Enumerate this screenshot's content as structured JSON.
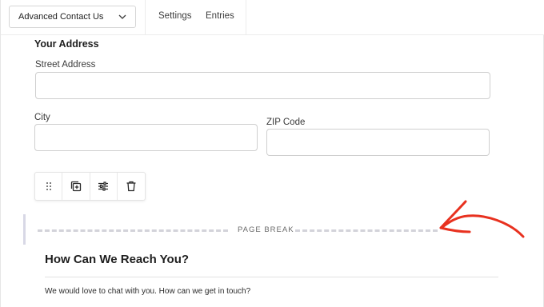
{
  "header": {
    "form_select": {
      "label": "Advanced Contact Us",
      "icon": "chevron-down-icon"
    },
    "tabs": [
      {
        "label": "Settings"
      },
      {
        "label": "Entries"
      }
    ]
  },
  "address_section": {
    "title": "Your Address",
    "fields": {
      "street": {
        "label": "Street Address",
        "value": ""
      },
      "city": {
        "label": "City",
        "value": ""
      },
      "zip": {
        "label": "ZIP Code",
        "value": ""
      }
    }
  },
  "block_toolbar": {
    "buttons": [
      {
        "icon": "drag-handle-icon"
      },
      {
        "icon": "duplicate-icon"
      },
      {
        "icon": "settings-sliders-icon"
      },
      {
        "icon": "trash-icon"
      }
    ]
  },
  "page_break": {
    "label": "PAGE BREAK"
  },
  "reach_section": {
    "title": "How Can We Reach You?",
    "description": "We would love to chat with you. How can we get in touch?"
  },
  "colors": {
    "annotation_arrow": "#e8311f",
    "input_border": "#cfcfcf",
    "page_break_dash": "#d3d3da"
  }
}
